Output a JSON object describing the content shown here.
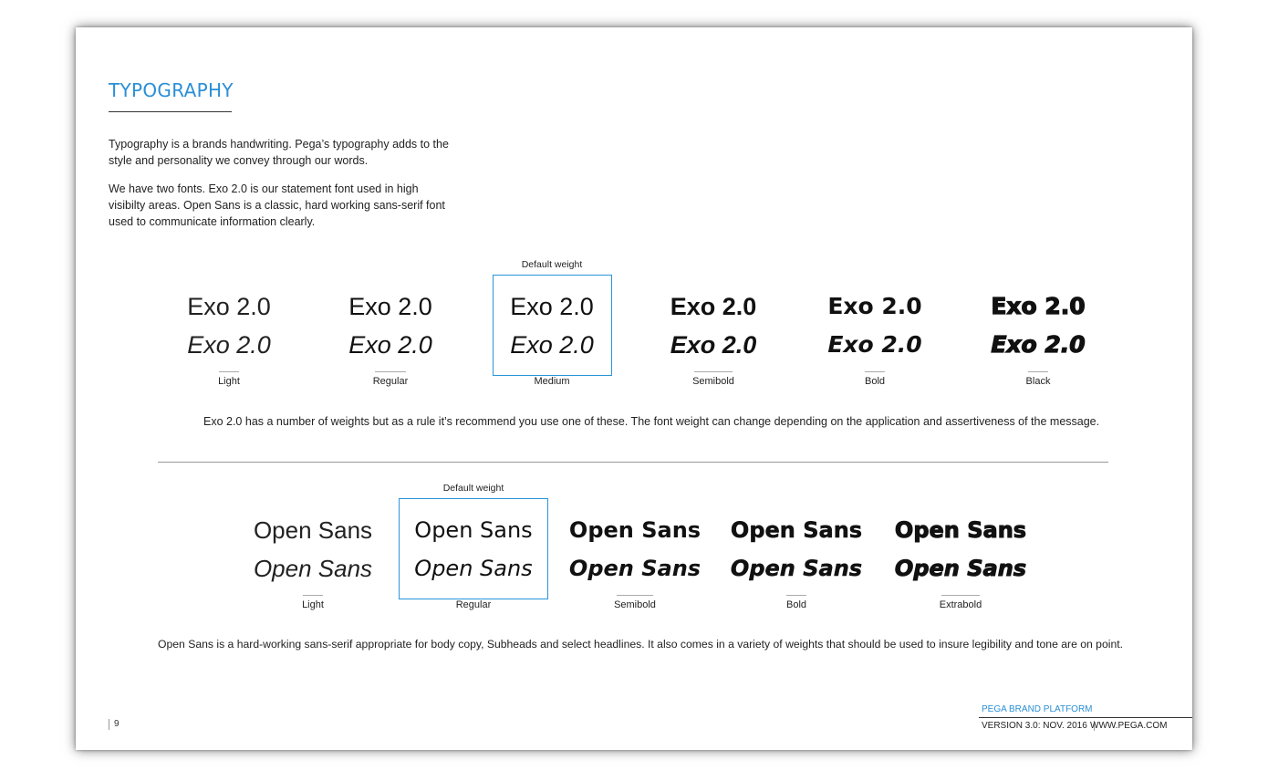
{
  "page": {
    "title": "TYPOGRAPHY",
    "intro_1": "Typography is a brands handwriting. Pega’s typography adds to the style and personality we convey through our words.",
    "intro_2": "We have two fonts. Exo 2.0 is our statement font used in high visibilty areas. Open Sans is a classic, hard working sans-serif font used to communicate information clearly."
  },
  "exo": {
    "default_label": "Default weight",
    "sample": "Exo 2.0",
    "weights": [
      "Light",
      "Regular",
      "Medium",
      "Semibold",
      "Bold",
      "Black"
    ],
    "default_index": 2,
    "caption": "Exo 2.0 has a number of weights but as a rule it’s recommend you use one of these. The font weight can change depending on the application and assertiveness of the message."
  },
  "opensans": {
    "default_label": "Default weight",
    "sample": "Open Sans",
    "weights": [
      "Light",
      "Regular",
      "Semibold",
      "Bold",
      "Extrabold"
    ],
    "default_index": 1,
    "caption": "Open Sans is a hard-working sans-serif appropriate for body copy, Subheads and select headlines. It also comes in a variety of weights that should be used to insure legibility and tone are on point."
  },
  "footer": {
    "page_number": "9",
    "brand": "PEGA BRAND PLATFORM",
    "version": "VERSION 3.0: NOV. 2016",
    "url": "WWW.PEGA.COM"
  },
  "colors": {
    "accent": "#2a8fd6",
    "highlight_border": "#2a95db"
  }
}
